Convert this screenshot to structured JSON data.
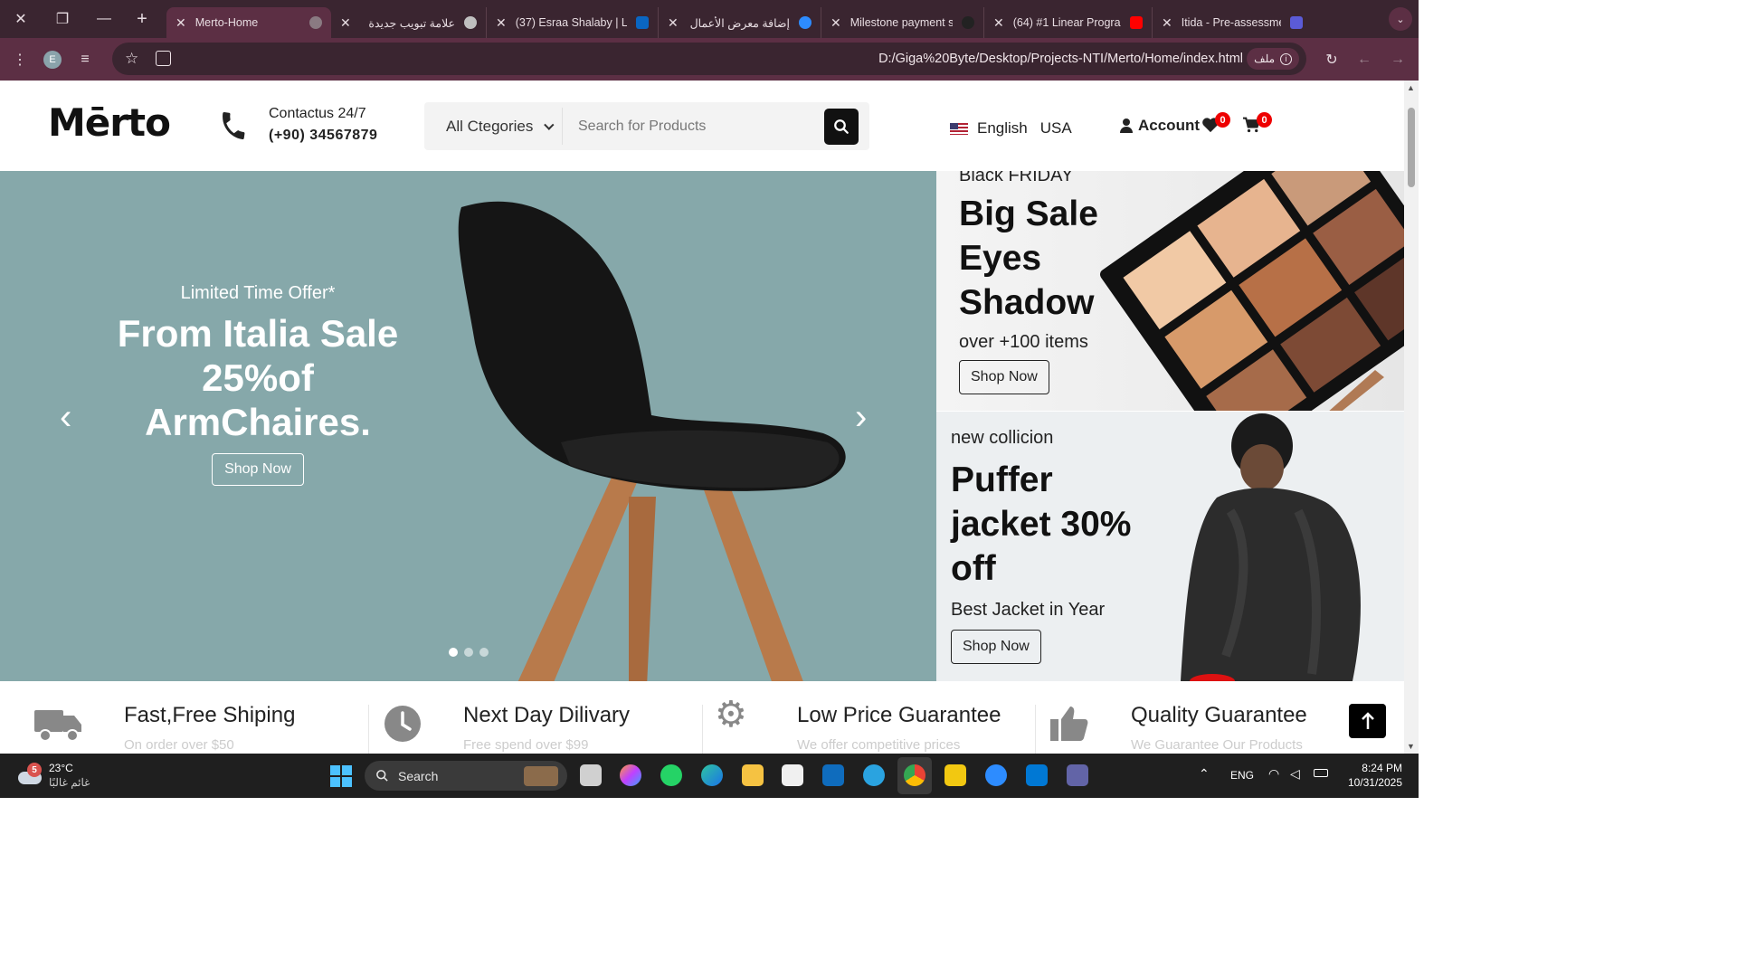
{
  "browser": {
    "tabs": [
      {
        "title": "Merto-Home",
        "active": true,
        "favicon_color": "#8a7a82"
      },
      {
        "title": "علامة تبويب جديدة",
        "active": false,
        "favicon_color": "#c0c0c0"
      },
      {
        "title": "(37) Esraa Shalaby | L",
        "active": false,
        "favicon_color": "#0a66c2"
      },
      {
        "title": "إضافة معرض الأعمال",
        "active": false,
        "favicon_color": "#2d8cff"
      },
      {
        "title": "Milestone payment s",
        "active": false,
        "favicon_color": "#222222"
      },
      {
        "title": "(64) #1 Linear Progra",
        "active": false,
        "favicon_color": "#ff0000"
      },
      {
        "title": "Itida - Pre-assessmen",
        "active": false,
        "favicon_color": "#5b5bd6"
      }
    ],
    "profile_initial": "E",
    "url": "D:/Giga%20Byte/Desktop/Projects-NTI/Merto/Home/index.html",
    "chip_label": "ملف"
  },
  "header": {
    "logo": "Mērto",
    "contact_label": "Contactus 24/7",
    "contact_phone": "(+90) 34567879",
    "category_label": "All Ctegories",
    "search_placeholder": "Search for Products",
    "language": "English",
    "country": "USA",
    "account_label": "Account",
    "wishlist_count": "0",
    "cart_count": "0"
  },
  "hero": {
    "subtitle": "Limited Time Offer*",
    "title": "From Italia Sale 25%of ArmChaires.",
    "button": "Shop Now",
    "slides": 3,
    "active_slide": 1
  },
  "promo1": {
    "eyebrow": "Black FRIDAY",
    "title": "Big Sale Eyes Shadow",
    "subtitle": "over +100 items",
    "button": "Shop Now"
  },
  "promo2": {
    "eyebrow": "new collicion",
    "title": "Puffer jacket 30% off",
    "subtitle": "Best Jacket in Year",
    "button": "Shop Now"
  },
  "features": [
    {
      "title": "Fast,Free Shiping",
      "subtitle": "On order over $50",
      "icon": "truck-icon"
    },
    {
      "title": "Next Day Dilivary",
      "subtitle": "Free spend over $99",
      "icon": "clock-icon"
    },
    {
      "title": "Low Price Guarantee",
      "subtitle": "We offer competitive prices",
      "icon": "gear-icon"
    },
    {
      "title": "Quality Guarantee",
      "subtitle": "We Guarantee Our Products",
      "icon": "thumbs-up-icon"
    }
  ],
  "taskbar": {
    "weather_temp": "23°C",
    "weather_desc": "غائم غالبًا",
    "weather_badge": "5",
    "search_label": "Search",
    "language": "ENG",
    "time": "8:24 PM",
    "date": "10/31/2025"
  },
  "colors": {
    "tabbar": "#3a2530",
    "toolbar": "#5c2f44",
    "hero_bg": "#86a8aa",
    "badge": "#ee0000"
  }
}
